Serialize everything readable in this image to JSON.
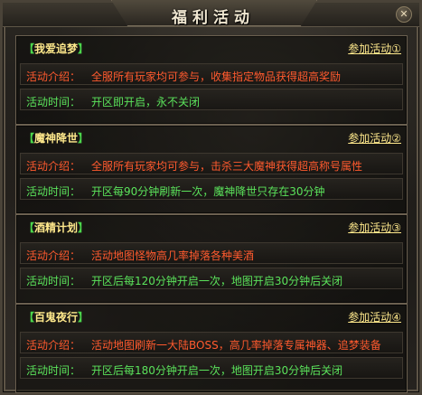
{
  "window": {
    "title": "福利活动",
    "close_glyph": "✕"
  },
  "cards": [
    {
      "name": "我爱追梦",
      "join_label": "参加活动①",
      "intro_label": "活动介绍：",
      "intro": "全服所有玩家均可参与，收集指定物品获得超高奖励",
      "time_label": "活动时间：",
      "time": "开区即开启，永不关闭"
    },
    {
      "name": "魔神降世",
      "join_label": "参加活动②",
      "intro_label": "活动介绍：",
      "intro": "全服所有玩家均可参与，击杀三大魔神获得超高称号属性",
      "time_label": "活动时间：",
      "time": "开区每90分钟刷新一次，魔神降世只存在30分钟"
    },
    {
      "name": "酒精计划",
      "join_label": "参加活动③",
      "intro_label": "活动介绍：",
      "intro": "活动地图怪物高几率掉落各种美酒",
      "time_label": "活动时间：",
      "time": "开区后每120分钟开启一次，地图开启30分钟后关闭"
    },
    {
      "name": "百鬼夜行",
      "join_label": "参加活动④",
      "intro_label": "活动介绍：",
      "intro": "活动地图刷新一大陆BOSS，高几率掉落专属神器、追梦装备",
      "time_label": "活动时间：",
      "time": "开区后每180分钟开启一次，地图开启30分钟后关闭"
    }
  ],
  "brackets": {
    "open": "【",
    "close": "】"
  },
  "colors": {
    "name": "#ffe98c",
    "bracket": "#4cd64c",
    "intro": "#ff5a2e",
    "time": "#5be35b",
    "border": "#6b6050"
  }
}
